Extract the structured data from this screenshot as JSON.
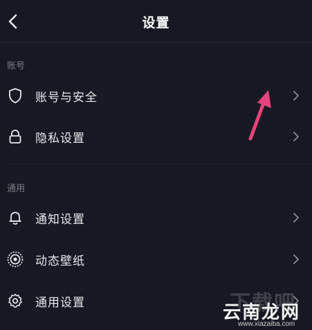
{
  "header": {
    "title": "设置"
  },
  "sections": [
    {
      "label": "账号",
      "items": [
        {
          "label": "账号与安全",
          "icon": "shield-icon"
        },
        {
          "label": "隐私设置",
          "icon": "lock-icon"
        }
      ]
    },
    {
      "label": "通用",
      "items": [
        {
          "label": "通知设置",
          "icon": "bell-icon"
        },
        {
          "label": "动态壁纸",
          "icon": "live-wallpaper-icon"
        },
        {
          "label": "通用设置",
          "icon": "gear-icon"
        }
      ]
    }
  ],
  "annotation": {
    "arrow_color": "#e8437a"
  },
  "watermark": {
    "bg_text": "下载吧",
    "text": "云南龙网",
    "url": "www.xiazaiba.com"
  },
  "colors": {
    "background": "#161823",
    "text": "#e8e8ec",
    "muted": "#7c7e87",
    "divider": "#252733"
  }
}
